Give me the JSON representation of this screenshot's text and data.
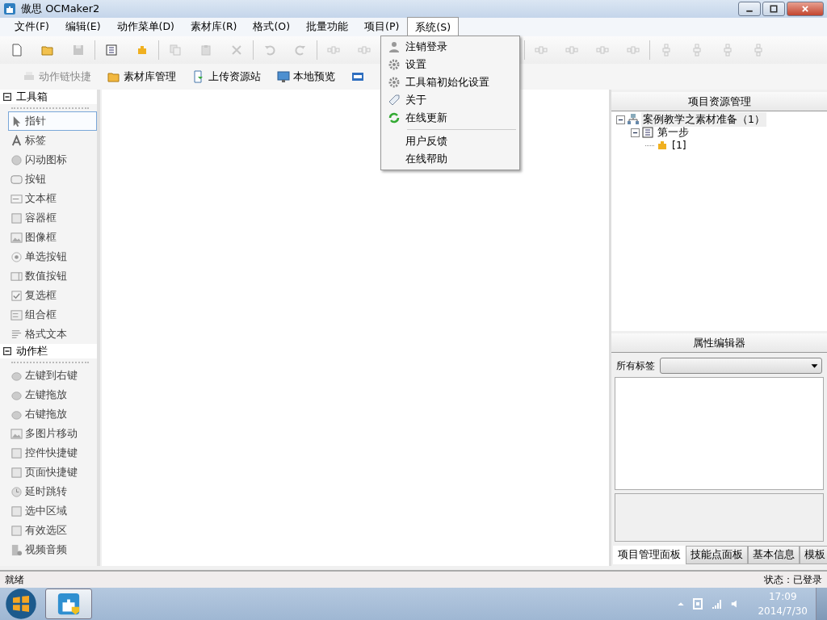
{
  "window": {
    "title": "傲思 OCMaker2"
  },
  "menu_bar": [
    {
      "label": "文件(F)",
      "selected": false
    },
    {
      "label": "编辑(E)",
      "selected": false
    },
    {
      "label": "动作菜单(D)",
      "selected": false
    },
    {
      "label": "素材库(R)",
      "selected": false
    },
    {
      "label": "格式(O)",
      "selected": false
    },
    {
      "label": "批量功能",
      "selected": false
    },
    {
      "label": "项目(P)",
      "selected": false
    },
    {
      "label": "系统(S)",
      "selected": true
    }
  ],
  "toolbar": [
    {
      "kind": "new",
      "disabled": false
    },
    {
      "kind": "open",
      "disabled": false
    },
    {
      "kind": "save",
      "disabled": true
    },
    {
      "kind": "separator"
    },
    {
      "kind": "page",
      "disabled": false
    },
    {
      "kind": "puzzle",
      "disabled": false
    },
    {
      "kind": "separator"
    },
    {
      "kind": "copy",
      "disabled": true
    },
    {
      "kind": "paste",
      "disabled": true
    },
    {
      "kind": "delete",
      "disabled": true
    },
    {
      "kind": "separator"
    },
    {
      "kind": "undo",
      "disabled": true
    },
    {
      "kind": "redo",
      "disabled": true
    },
    {
      "kind": "separator"
    },
    {
      "kind": "align",
      "disabled": true
    },
    {
      "kind": "align",
      "disabled": true
    },
    {
      "kind": "hidden"
    },
    {
      "kind": "separator"
    },
    {
      "kind": "align",
      "disabled": true
    },
    {
      "kind": "align",
      "disabled": true
    },
    {
      "kind": "align",
      "disabled": true
    },
    {
      "kind": "align",
      "disabled": true
    },
    {
      "kind": "separator"
    },
    {
      "kind": "valign",
      "disabled": true
    },
    {
      "kind": "valign",
      "disabled": true
    },
    {
      "kind": "valign",
      "disabled": true
    },
    {
      "kind": "valign",
      "disabled": true
    }
  ],
  "quick_bar": [
    {
      "label": "动作链快捷",
      "kind": "chain",
      "disabled": true
    },
    {
      "label": "素材库管理",
      "kind": "folder",
      "disabled": false
    },
    {
      "label": "上传资源站",
      "kind": "upload",
      "disabled": false
    },
    {
      "label": "本地预览",
      "kind": "monitor",
      "disabled": false
    },
    {
      "kind": "html",
      "disabled": false
    }
  ],
  "toolbox": [
    {
      "title": "工具箱",
      "expanded": true,
      "items": [
        {
          "label": "指针",
          "kind": "pointer",
          "selected": true
        },
        {
          "label": "标签",
          "kind": "letter",
          "selected": false
        },
        {
          "label": "闪动图标",
          "kind": "ball",
          "selected": false
        },
        {
          "label": "按钮",
          "kind": "button",
          "selected": false
        },
        {
          "label": "文本框",
          "kind": "textbox",
          "selected": false
        },
        {
          "label": "容器框",
          "kind": "frame",
          "selected": false
        },
        {
          "label": "图像框",
          "kind": "image",
          "selected": false
        },
        {
          "label": "单选按钮",
          "kind": "radio",
          "selected": false
        },
        {
          "label": "数值按钮",
          "kind": "spinner",
          "selected": false
        },
        {
          "label": "复选框",
          "kind": "checkbox",
          "selected": false
        },
        {
          "label": "组合框",
          "kind": "combo",
          "selected": false
        },
        {
          "label": "格式文本",
          "kind": "richtext",
          "selected": false
        }
      ]
    },
    {
      "title": "动作栏",
      "expanded": true,
      "items": [
        {
          "label": "左键到右键",
          "kind": "mouse",
          "selected": false
        },
        {
          "label": "左键拖放",
          "kind": "mouse",
          "selected": false
        },
        {
          "label": "右键拖放",
          "kind": "mouse",
          "selected": false
        },
        {
          "label": "多图片移动",
          "kind": "image",
          "selected": false
        },
        {
          "label": "控件快捷键",
          "kind": "frame",
          "selected": false
        },
        {
          "label": "页面快捷键",
          "kind": "frame",
          "selected": false
        },
        {
          "label": "延时跳转",
          "kind": "clock",
          "selected": false
        },
        {
          "label": "选中区域",
          "kind": "frame",
          "selected": false
        },
        {
          "label": "有效选区",
          "kind": "frame",
          "selected": false
        },
        {
          "label": "视频音频",
          "kind": "film",
          "selected": false
        }
      ]
    }
  ],
  "system_menu": [
    {
      "kind": "user",
      "label": "注销登录"
    },
    {
      "kind": "gear",
      "label": "设置"
    },
    {
      "kind": "gear",
      "label": "工具箱初始化设置"
    },
    {
      "kind": "tag",
      "label": "关于"
    },
    {
      "kind": "refresh",
      "label": "在线更新"
    },
    {
      "kind": "separator"
    },
    {
      "kind": "plain",
      "label": "用户反馈"
    },
    {
      "kind": "plain",
      "label": "在线帮助"
    }
  ],
  "resource_panel": {
    "title": "项目资源管理",
    "tree": [
      {
        "label": "案例教学之素材准备（1）",
        "kind": "project",
        "expanded": true,
        "selected": true,
        "children": [
          {
            "label": "第一步",
            "kind": "page",
            "expanded": true,
            "selected": false,
            "children": [
              {
                "label": "[1]",
                "kind": "puzzle",
                "selected": false
              }
            ]
          }
        ]
      }
    ]
  },
  "property_editor": {
    "title": "属性编辑器",
    "filter_label": "所有标签"
  },
  "panel_tabs": [
    {
      "label": "项目管理面板",
      "selected": true
    },
    {
      "label": "技能点面板",
      "selected": false
    },
    {
      "label": "基本信息",
      "selected": false
    },
    {
      "label": "模板",
      "selected": false
    }
  ],
  "status_bar": {
    "message": "就绪",
    "login_status": "状态：已登录"
  },
  "taskbar": {
    "time": "17:09",
    "date": "2014/7/30"
  }
}
